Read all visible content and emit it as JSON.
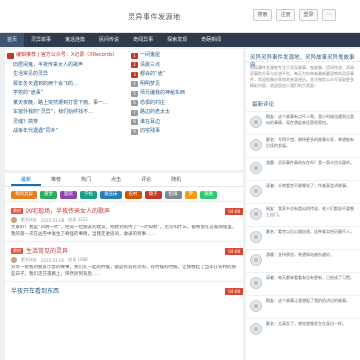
{
  "header": {
    "site_title": "灵异事件发源地",
    "btn_search": "搜索",
    "btn_register": "注册",
    "btn_login": "登录",
    "btn_extra": "⋯"
  },
  "nav": [
    "首页",
    "灵异故事",
    "鬼话连篇",
    "民间传说",
    "奇闻异事",
    "探索发现",
    "奇葩新闻"
  ],
  "left_list": [
    {
      "badge": "",
      "text": "编辑推荐 | 官方公众号：X记录（XRecords）",
      "hl": true
    },
    {
      "badge": "",
      "text": "旧居闹鬼，半夜传来女人的歌声",
      "hl": false
    },
    {
      "badge": "",
      "text": "生活常见的灵异",
      "hl": false
    },
    {
      "badge": "",
      "text": "那年冬天遇到的两个会飞的…",
      "hl": false
    },
    {
      "badge": "",
      "text": "学校的“诡事”",
      "hl": false
    },
    {
      "badge": "",
      "text": "某天夜晚，路上突然遭到打雷下雨，事一…",
      "hl": false
    },
    {
      "badge": "",
      "text": "车窗外我的“灵异”，我们始终找不…",
      "hl": false
    },
    {
      "badge": "",
      "text": "灵魂？搞穿",
      "hl": false
    },
    {
      "badge": "",
      "text": "战争年代遇遇“同乡”",
      "hl": false
    }
  ],
  "right_list": [
    {
      "badge": "1",
      "text": "一间鬼屋",
      "red": true
    },
    {
      "badge": "2",
      "text": "清晨三点",
      "red": true
    },
    {
      "badge": "3",
      "text": "都会的“诡”",
      "red": true
    },
    {
      "badge": "4",
      "text": "明明梦见",
      "red": false
    },
    {
      "badge": "5",
      "text": "师兄编我的神秘东西",
      "red": false
    },
    {
      "badge": "6",
      "text": "恐惧的村庄",
      "red": false
    },
    {
      "badge": "7",
      "text": "路边的老太太",
      "red": false
    },
    {
      "badge": "8",
      "text": "谁在耳边",
      "red": false
    },
    {
      "badge": "9",
      "text": "旧宅残事",
      "red": false
    }
  ],
  "tabs": [
    "最新",
    "推荐",
    "热门",
    "点击",
    "评论",
    "随机"
  ],
  "tags": [
    {
      "label": "我的灵异",
      "color": "#e67e22"
    },
    {
      "label": "噩梦",
      "color": "#27ae60"
    },
    {
      "label": "医院",
      "color": "#8e44ad"
    },
    {
      "label": "学校",
      "color": "#16a085"
    },
    {
      "label": "鬼压床",
      "color": "#2980b9"
    },
    {
      "label": "农村",
      "color": "#d35400"
    },
    {
      "label": "镜子",
      "color": "#c0392b"
    },
    {
      "label": "招魂",
      "color": "#7f8c8d"
    },
    {
      "label": "梦",
      "color": "#f39c12"
    },
    {
      "label": "夜路",
      "color": "#2ecc71"
    }
  ],
  "articles": [
    {
      "title": "凶宅现场，半夜传来女人的歌声",
      "cat": "原创",
      "meta_author": "匿名网友",
      "meta_time": "2022-01-08",
      "meta_views": "阅读 3215",
      "date": "04-08",
      "body": "大家好！我是“刘明一叶”，经常一位朋友的建议，把爬到的传了“一叶知秋”，无论叫什么，都希望在这家网站里，我的第一次在凶宅中发生了奇怪的事情，当我走进房间，收录的到事……",
      "blue": false
    },
    {
      "title": "生活常见的灵异",
      "cat": "原创",
      "meta_author": "匿名网友",
      "meta_time": "2022-01-05",
      "meta_views": "阅读 1688",
      "date": "04-08",
      "body": "分享一则我对朋友小曾的故事，我们在一起的时候，都是有说有笑的，有时候的时候，让我想起了当年在农村的那些日子，我们走在夜路上，突然听到背后……",
      "blue": false
    },
    {
      "title": "半夜开车看到东西",
      "cat": "",
      "meta_author": "",
      "meta_time": "",
      "meta_views": "",
      "date": "04-08",
      "body": "",
      "blue": true
    }
  ],
  "sidebar": {
    "header": "灵异灵异事件发源地，灵异故事灵异鬼故事网",
    "intro": "灵异事件发源地专注于灵异故事、鬼故事、民间传说、奇闻异事的分享与交流平台，每天为你带来最新最恐怖的灵异事件，欢迎投稿分享你的亲身经历。关注微信公众号获取更多精彩内容，欢迎您加入我们的大家庭！",
    "comments_title": "最新评论",
    "comments": [
      {
        "name": "网友",
        "text": "这个故事有点吓人啊，我小时候也遇到过类似的事情，现在想起来还是很害怕。"
      },
      {
        "name": "匿名",
        "text": "写得不错，期待更多的故事分享，希望能有后续的发展。"
      },
      {
        "name": "游客",
        "text": "灵异事件真的存在吗？我一直半信半疑的。"
      },
      {
        "name": "读者",
        "text": "半夜看完不敢睡觉了，作者真会讲故事。"
      },
      {
        "name": "网友",
        "text": "我家乡也有类似的传说，老人们都说不要晚上出门。"
      },
      {
        "name": "匿名",
        "text": "看完以后心跳加速，这种真实经历最吓人。"
      },
      {
        "name": "游客",
        "text": "支持原创，希望网站越办越好。"
      },
      {
        "name": "读者",
        "text": "每天都来看看有没有更新，已经成了习惯。"
      },
      {
        "name": "网友",
        "text": "这个故事让我想起了我奶奶讲过的故事。"
      },
      {
        "name": "匿名",
        "text": "太真实了，感觉就像发生在身边一样。"
      }
    ]
  }
}
